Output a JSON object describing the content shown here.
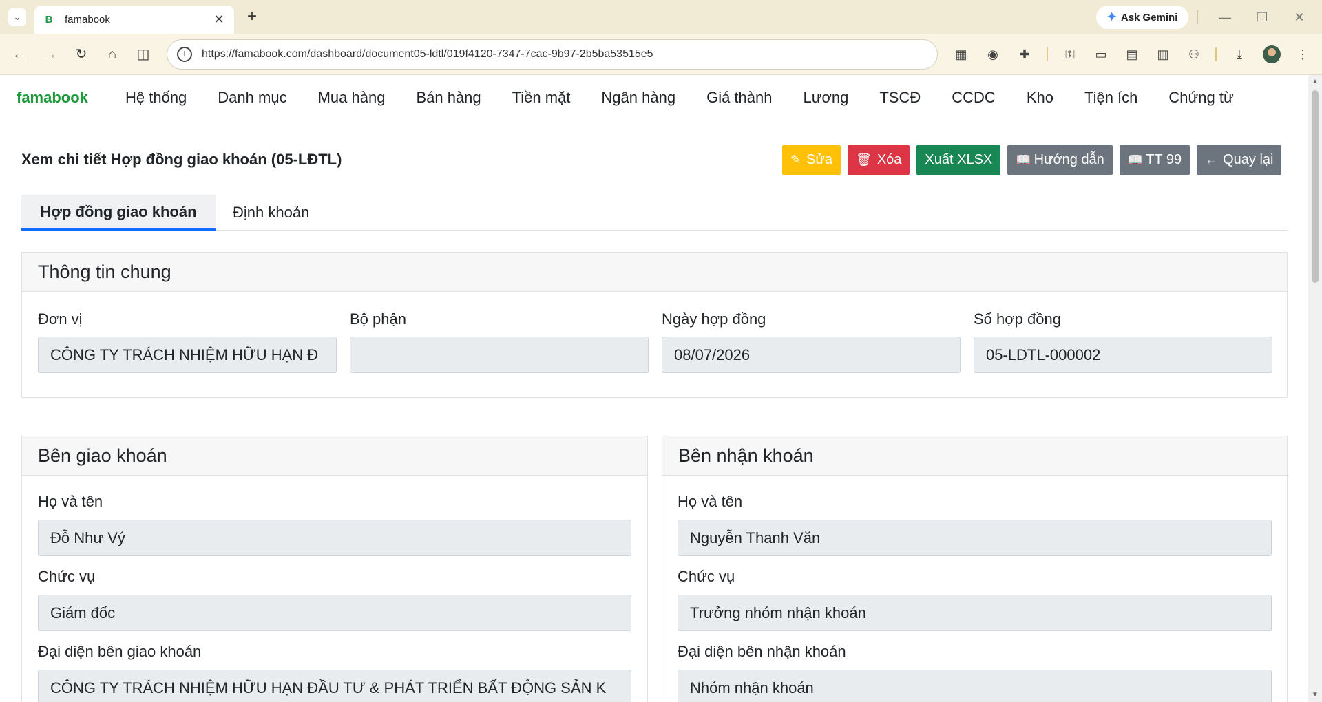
{
  "browser": {
    "tab_title": "famabook",
    "favicon_letter": "B",
    "new_tab_glyph": "+",
    "gemini_label": "Ask Gemini",
    "url": "https://famabook.com/dashboard/document05-ldtl/019f4120-7347-7cac-9b97-2b5ba53515e5"
  },
  "nav": {
    "brand": "famabook",
    "menu": [
      "Hệ thống",
      "Danh mục",
      "Mua hàng",
      "Bán hàng",
      "Tiền mặt",
      "Ngân hàng",
      "Giá thành",
      "Lương",
      "TSCĐ",
      "CCDC",
      "Kho",
      "Tiện ích",
      "Chứng từ"
    ]
  },
  "page": {
    "title": "Xem chi tiết Hợp đồng giao khoán (05-LĐTL)"
  },
  "actions": {
    "edit": "Sửa",
    "delete": "Xóa",
    "export": "Xuất XLSX",
    "guide": "Hướng dẫn",
    "tt99": "TT 99",
    "back": "Quay lại"
  },
  "tabs": {
    "contract": "Hợp đồng giao khoán",
    "entry": "Định khoản"
  },
  "general": {
    "header": "Thông tin chung",
    "unit_label": "Đơn vị",
    "unit_value": "CÔNG TY TRÁCH NHIỆM HỮU HẠN Đ",
    "dept_label": "Bộ phận",
    "dept_value": "",
    "date_label": "Ngày hợp đồng",
    "date_value": "08/07/2026",
    "number_label": "Số hợp đồng",
    "number_value": "05-LDTL-000002"
  },
  "giver": {
    "header": "Bên giao khoán",
    "name_label": "Họ và tên",
    "name_value": "Đỗ Như Vý",
    "position_label": "Chức vụ",
    "position_value": "Giám đốc",
    "rep_label": "Đại diện bên giao khoán",
    "rep_value": "CÔNG TY TRÁCH NHIỆM HỮU HẠN ĐẦU TƯ & PHÁT TRIỂN BẤT ĐỘNG SẢN K"
  },
  "receiver": {
    "header": "Bên nhận khoán",
    "name_label": "Họ và tên",
    "name_value": "Nguyễn Thanh Văn",
    "position_label": "Chức vụ",
    "position_value": "Trưởng nhóm nhận khoán",
    "rep_label": "Đại diện bên nhận khoán",
    "rep_value": "Nhóm nhận khoán"
  },
  "colors": {
    "brand": "#1e9a3b",
    "warning": "#ffc107",
    "danger": "#dc3545",
    "success": "#198754",
    "secondary": "#6c757d",
    "tab_active_border": "#0d6efd"
  }
}
